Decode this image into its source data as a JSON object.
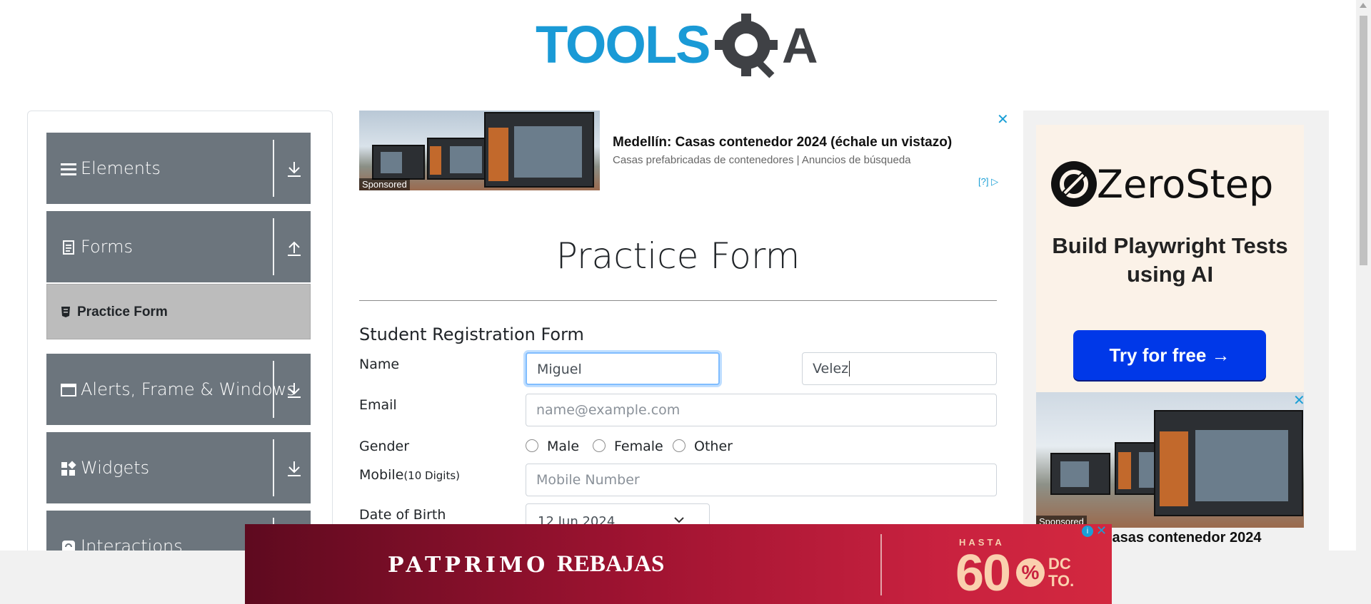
{
  "logo": {
    "text_left": "TOOLS",
    "text_right": "A",
    "colors": {
      "tools": "#1a9ad6",
      "qa": "#3f4145"
    }
  },
  "sidebar": {
    "groups": [
      {
        "label": "Elements",
        "icon": "menu-icon",
        "state": "collapsed"
      },
      {
        "label": "Forms",
        "icon": "document-icon",
        "state": "expanded"
      },
      {
        "label": "Alerts, Frame & Windows",
        "icon": "window-icon",
        "state": "collapsed"
      },
      {
        "label": "Widgets",
        "icon": "widgets-icon",
        "state": "collapsed"
      },
      {
        "label": "Interactions",
        "icon": "refresh-icon",
        "state": "collapsed"
      }
    ],
    "active_item": {
      "label": "Practice Form",
      "icon": "form-icon"
    }
  },
  "top_ad": {
    "title": "Medellín: Casas contenedor 2024 (échale un vistazo)",
    "subtitle": "Casas prefabricadas de contenedores | Anuncios de búsqueda",
    "sponsored": "Sponsored",
    "badge": "[?]",
    "close": "✕"
  },
  "main": {
    "page_title": "Practice Form",
    "form_heading": "Student Registration Form",
    "labels": {
      "name": "Name",
      "email": "Email",
      "gender": "Gender",
      "mobile": "Mobile",
      "mobile_hint": "(10 Digits)",
      "dob": "Date of Birth"
    },
    "first_name": "Miguel",
    "last_name": "Velez",
    "email_placeholder": "name@example.com",
    "gender_options": [
      "Male",
      "Female",
      "Other"
    ],
    "mobile_placeholder": "Mobile Number",
    "dob_value": "12 Jun 2024"
  },
  "right_ad": {
    "brand": "ZeroStep",
    "tagline": "Build Playwright Tests using AI",
    "cta": "Try for free →",
    "sponsored": "Sponsored",
    "headline": "Casas contenedor 2024",
    "close": "✕"
  },
  "banner": {
    "brand": "PATPRIMO",
    "sale": "REBAJAS",
    "hasta": "HASTA",
    "discount": "60",
    "percent": "%",
    "dcto": "DC TO.",
    "close": "✕",
    "info": "i"
  }
}
